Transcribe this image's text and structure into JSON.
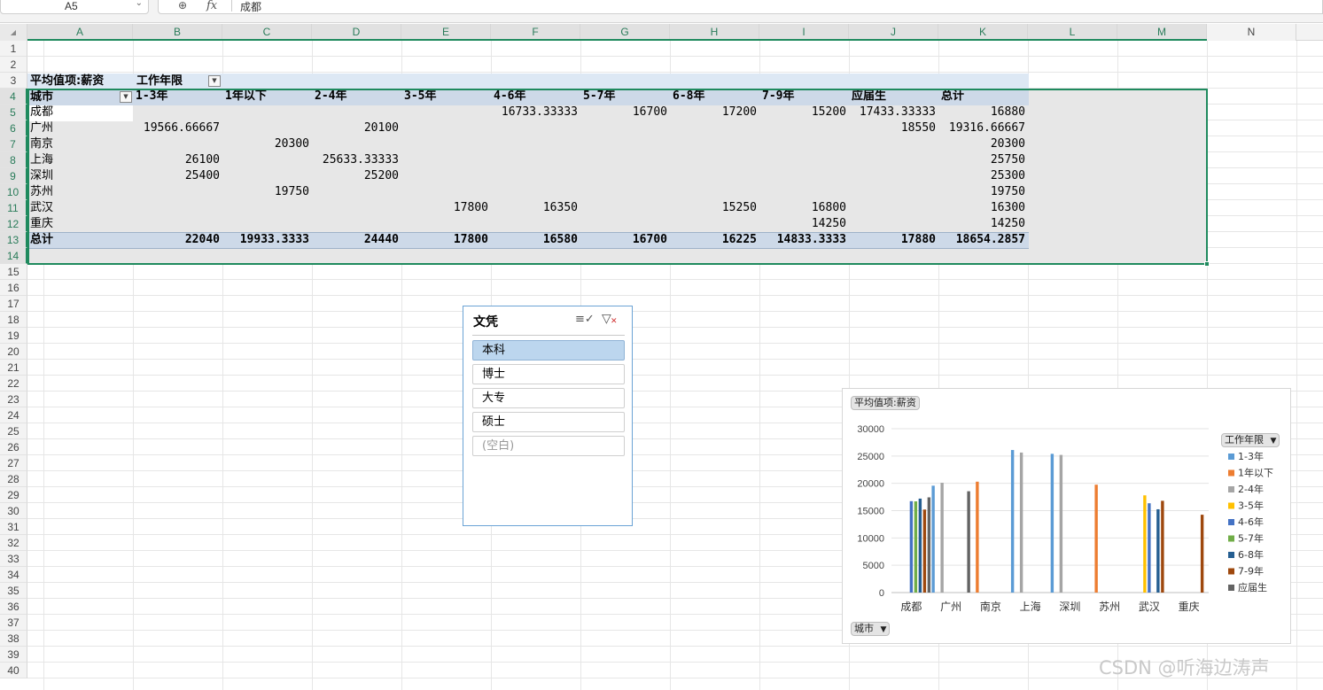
{
  "formula_bar": {
    "name_box": "A5",
    "value": "成都"
  },
  "columns": [
    "A",
    "B",
    "C",
    "D",
    "E",
    "F",
    "G",
    "H",
    "I",
    "J",
    "K",
    "L",
    "M",
    "N"
  ],
  "rows": [
    "1",
    "2",
    "3",
    "4",
    "5",
    "6",
    "7",
    "8",
    "9",
    "10",
    "11",
    "12",
    "13",
    "14",
    "15",
    "16",
    "17",
    "18",
    "19",
    "20",
    "21",
    "22",
    "23",
    "24",
    "25",
    "26",
    "27",
    "28",
    "29",
    "30",
    "31",
    "32",
    "33",
    "34",
    "35",
    "36",
    "37",
    "38",
    "39",
    "40"
  ],
  "pivot": {
    "value_label": "平均值项:薪资",
    "column_field": "工作年限",
    "row_field": "城市",
    "headers": [
      "1-3年",
      "1年以下",
      "2-4年",
      "3-5年",
      "4-6年",
      "5-7年",
      "6-8年",
      "7-9年",
      "应届生",
      "总计"
    ],
    "body": [
      [
        "成都",
        "",
        "",
        "",
        "",
        "16733.33333",
        "16700",
        "17200",
        "15200",
        "17433.33333",
        "16880"
      ],
      [
        "广州",
        "19566.66667",
        "",
        "20100",
        "",
        "",
        "",
        "",
        "",
        "18550",
        "19316.66667"
      ],
      [
        "南京",
        "",
        "20300",
        "",
        "",
        "",
        "",
        "",
        "",
        "",
        "20300"
      ],
      [
        "上海",
        "26100",
        "",
        "25633.33333",
        "",
        "",
        "",
        "",
        "",
        "",
        "25750"
      ],
      [
        "深圳",
        "25400",
        "",
        "25200",
        "",
        "",
        "",
        "",
        "",
        "",
        "25300"
      ],
      [
        "苏州",
        "",
        "19750",
        "",
        "",
        "",
        "",
        "",
        "",
        "",
        "19750"
      ],
      [
        "武汉",
        "",
        "",
        "",
        "17800",
        "16350",
        "",
        "15250",
        "16800",
        "",
        "16300"
      ],
      [
        "重庆",
        "",
        "",
        "",
        "",
        "",
        "",
        "",
        "14250",
        "",
        "14250"
      ]
    ],
    "total": [
      "总计",
      "22040",
      "19933.3333",
      "24440",
      "17800",
      "16580",
      "16700",
      "16225",
      "14833.3333",
      "17880",
      "18654.2857"
    ]
  },
  "slicer": {
    "title": "文凭",
    "items": [
      "本科",
      "博士",
      "大专",
      "硕士",
      "(空白)"
    ],
    "selected": "本科"
  },
  "chart_data": {
    "type": "bar",
    "value_field_button": "平均值项:薪资",
    "legend_field_button": "工作年限",
    "axis_field_button": "城市",
    "categories": [
      "成都",
      "广州",
      "南京",
      "上海",
      "深圳",
      "苏州",
      "武汉",
      "重庆"
    ],
    "ylim": [
      0,
      30000
    ],
    "yticks": [
      "0",
      "5000",
      "10000",
      "15000",
      "20000",
      "25000",
      "30000"
    ],
    "grid": true,
    "legend_position": "right",
    "series": [
      {
        "name": "1-3年",
        "color": "#5b9bd5",
        "values": [
          null,
          19566.67,
          null,
          26100,
          25400,
          null,
          null,
          null
        ]
      },
      {
        "name": "1年以下",
        "color": "#ed7d31",
        "values": [
          null,
          null,
          20300,
          null,
          null,
          19750,
          null,
          null
        ]
      },
      {
        "name": "2-4年",
        "color": "#a5a5a5",
        "values": [
          null,
          20100,
          null,
          25633.33,
          25200,
          null,
          null,
          null
        ]
      },
      {
        "name": "3-5年",
        "color": "#ffc000",
        "values": [
          null,
          null,
          null,
          null,
          null,
          null,
          17800,
          null
        ]
      },
      {
        "name": "4-6年",
        "color": "#4472c4",
        "values": [
          16733.33,
          null,
          null,
          null,
          null,
          null,
          16350,
          null
        ]
      },
      {
        "name": "5-7年",
        "color": "#70ad47",
        "values": [
          16700,
          null,
          null,
          null,
          null,
          null,
          null,
          null
        ]
      },
      {
        "name": "6-8年",
        "color": "#255e91",
        "values": [
          17200,
          null,
          null,
          null,
          null,
          null,
          15250,
          null
        ]
      },
      {
        "name": "7-9年",
        "color": "#9e480e",
        "values": [
          15200,
          null,
          null,
          null,
          null,
          null,
          16800,
          14250
        ]
      },
      {
        "name": "应届生",
        "color": "#636363",
        "values": [
          17433.33,
          18550,
          null,
          null,
          null,
          null,
          null,
          null
        ]
      }
    ]
  },
  "watermark": "CSDN @听海边涛声"
}
